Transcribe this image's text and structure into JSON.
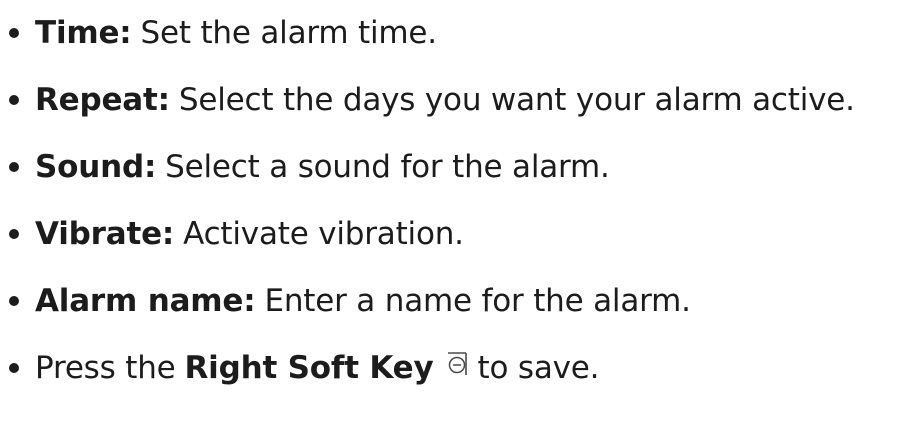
{
  "items": [
    {
      "term": "Time:",
      "text": "Set the alarm time."
    },
    {
      "term": "Repeat:",
      "text": "Select the days you want your alarm active."
    },
    {
      "term": "Sound:",
      "text": "Select a sound for the alarm."
    },
    {
      "term": "Vibrate:",
      "text": "Activate vibration."
    },
    {
      "term": "Alarm name:",
      "text": "Enter a name for the alarm."
    }
  ],
  "final_step": {
    "prefix": "Press the",
    "key_label": "Right Soft Key",
    "key_icon": "right-soft-key-icon",
    "suffix": "to save."
  }
}
